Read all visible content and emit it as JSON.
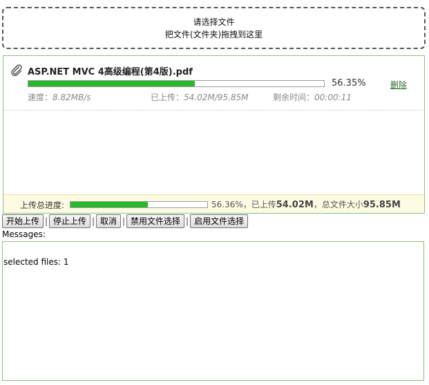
{
  "dropzone": {
    "line1": "请选择文件",
    "line2": "把文件(文件夹)拖拽到这里"
  },
  "file": {
    "name": "ASP.NET MVC 4高级编程(第4版).pdf",
    "progress_fraction": 0.5635,
    "percent": "56.35%",
    "delete_label": "删除",
    "speed_label": "速度：",
    "speed_value": "8.82MB/s",
    "uploaded_label": "已上传：",
    "uploaded_value": "54.02M/95.85M",
    "remaining_label": "剩余时间：",
    "remaining_value": "00:00:11",
    "icon": "paperclip-icon",
    "bar_color": "#28b82c"
  },
  "summary": {
    "label": "上传总进度:",
    "progress_fraction": 0.5636,
    "percent_text": "56.36%，已上传",
    "uploaded": "54.02M",
    "size_text": "，总文件大小",
    "total": "95.85M"
  },
  "toolbar": {
    "start": "开始上传",
    "stop": "停止上传",
    "cancel": "取消",
    "disable": "禁用文件选择",
    "enable": "启用文件选择",
    "separator": "|"
  },
  "messages": {
    "label": "Messages:",
    "line": "selected files: 1"
  },
  "colors": {
    "panel_border": "#8fbf7a",
    "summary_bg": "#fdfbe2"
  }
}
